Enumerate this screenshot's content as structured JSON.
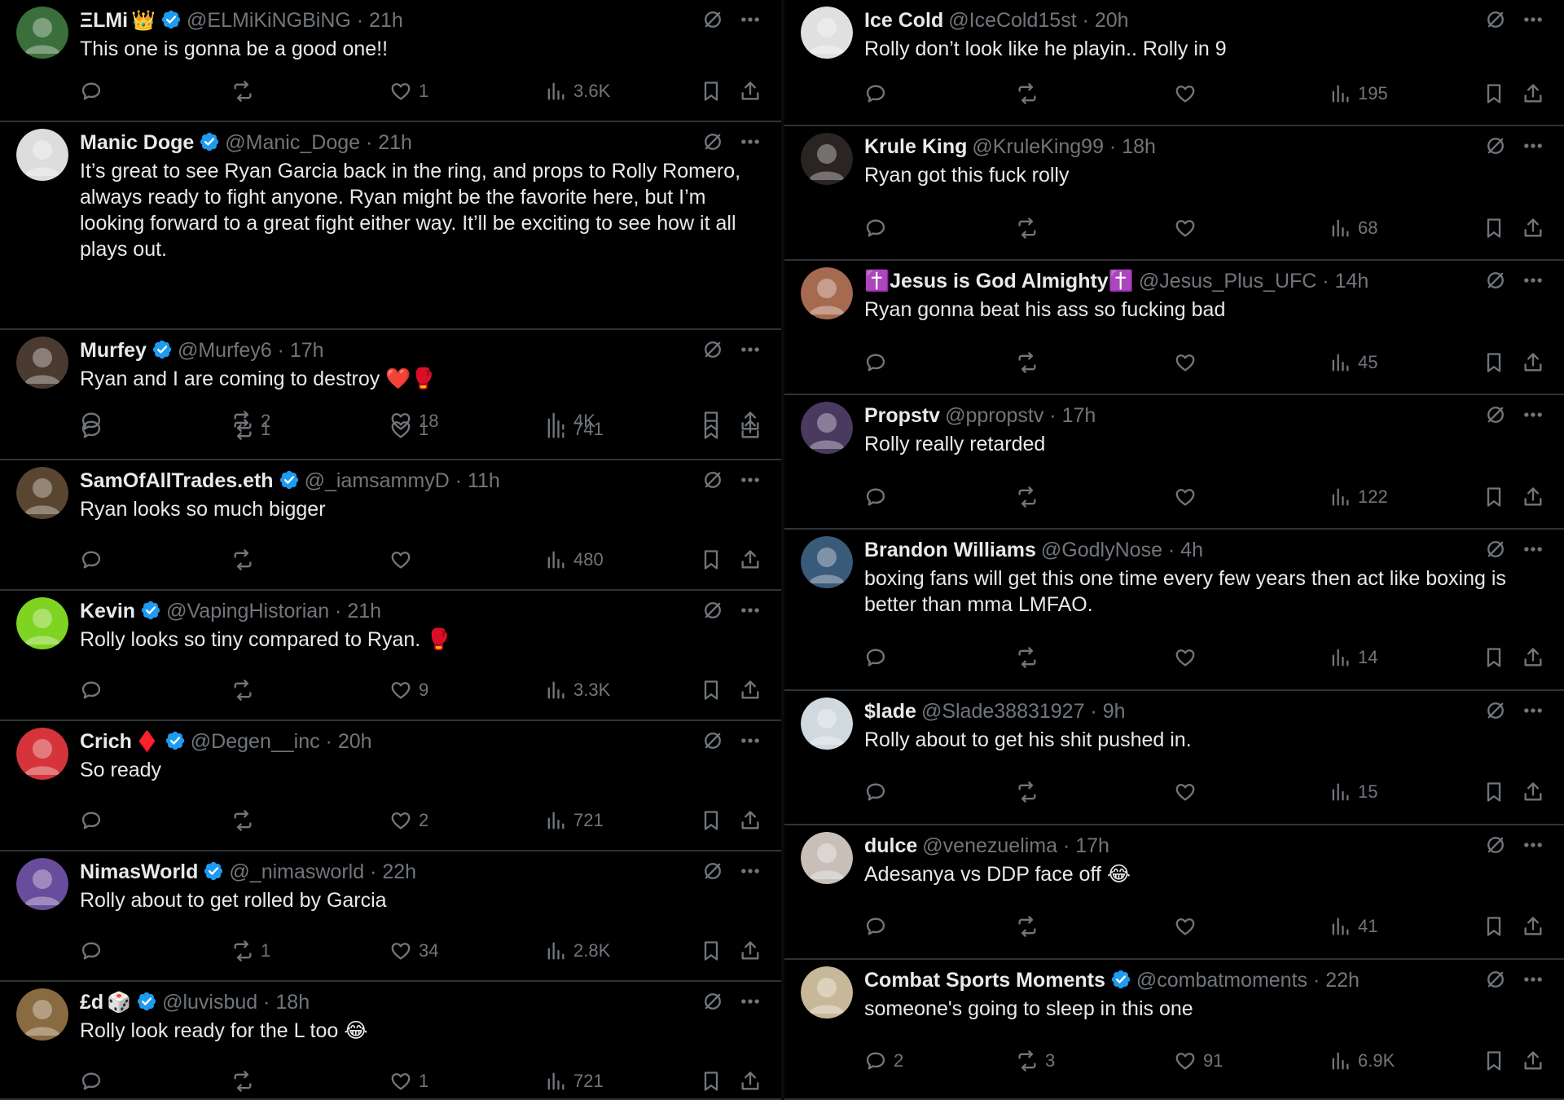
{
  "left": [
    {
      "name": "ΞLMi",
      "emoji": "👑",
      "verified": true,
      "handle": "@ELMiKiNGBiNG",
      "time": "21h",
      "text": "This one is gonna be a good one!!",
      "reply": "",
      "rt": "",
      "like": "1",
      "views": "3.6K",
      "avatar_color": "#3a6e3a"
    },
    {
      "name": "Manic Doge",
      "emoji": "",
      "verified": true,
      "handle": "@Manic_Doge",
      "time": "21h",
      "text": "It’s great to see Ryan Garcia back in the ring, and props to Rolly Romero, always ready to fight anyone. Ryan might be the favorite here, but I’m looking forward to a great fight either way. It’ll be exciting to see how it all plays out.",
      "reply": "",
      "rt": "2",
      "like": "18",
      "views": "4K",
      "avatar_color": "#dddddd"
    },
    {
      "name": "Murfey",
      "emoji": "",
      "verified": true,
      "handle": "@Murfey6",
      "time": "17h",
      "text": "Ryan and I are coming to destroy ❤️🥊",
      "reply": "",
      "rt": "1",
      "like": "1",
      "views": "741",
      "avatar_color": "#4a3a30"
    },
    {
      "name": "SamOfAllTrades.eth",
      "emoji": "",
      "verified": true,
      "handle": "@_iamsammyD",
      "time": "11h",
      "text": "Ryan looks so much bigger",
      "reply": "",
      "rt": "",
      "like": "",
      "views": "480",
      "avatar_color": "#5a4630"
    },
    {
      "name": "Kevin",
      "emoji": "",
      "verified": true,
      "handle": "@VapingHistorian",
      "time": "21h",
      "text": "Rolly looks so tiny compared to Ryan. 🥊",
      "reply": "",
      "rt": "",
      "like": "9",
      "views": "3.3K",
      "avatar_color": "#7fd321"
    },
    {
      "name": "Crich",
      "emoji": "♦️",
      "verified": true,
      "handle": "@Degen__inc",
      "time": "20h",
      "text": "So ready",
      "reply": "",
      "rt": "",
      "like": "2",
      "views": "721",
      "avatar_color": "#d4343a"
    },
    {
      "name": "NimasWorld",
      "emoji": "",
      "verified": true,
      "handle": "@_nimasworld",
      "time": "22h",
      "text": "Rolly about to get rolled by Garcia",
      "reply": "",
      "rt": "1",
      "like": "34",
      "views": "2.8K",
      "avatar_color": "#6a4c9c"
    },
    {
      "name": "£d",
      "emoji": "🎲",
      "verified": true,
      "handle": "@luvisbud",
      "time": "18h",
      "text": "Rolly look ready for the L too 😂",
      "reply": "",
      "rt": "",
      "like": "1",
      "views": "721",
      "avatar_color": "#8a6a40"
    }
  ],
  "right": [
    {
      "name": "Ice Cold",
      "emoji": "",
      "verified": false,
      "handle": "@IceCold15st",
      "time": "20h",
      "text": "Rolly don’t look like he playin.. Rolly in 9",
      "reply": "",
      "rt": "",
      "like": "",
      "views": "195",
      "avatar_color": "#e0e0e0"
    },
    {
      "name": "Krule King",
      "emoji": "",
      "verified": false,
      "handle": "@KruleKing99",
      "time": "18h",
      "text": "Ryan got this fuck rolly",
      "reply": "",
      "rt": "",
      "like": "",
      "views": "68",
      "avatar_color": "#2a2422"
    },
    {
      "name": "✝️Jesus is God Almighty✝️",
      "emoji": "",
      "verified": false,
      "handle": "@Jesus_Plus_UFC",
      "time": "14h",
      "text": "Ryan gonna beat his ass so fucking bad",
      "reply": "",
      "rt": "",
      "like": "",
      "views": "45",
      "avatar_color": "#a66a50"
    },
    {
      "name": "Propstv",
      "emoji": "",
      "verified": false,
      "handle": "@ppropstv",
      "time": "17h",
      "text": "Rolly really retarded",
      "reply": "",
      "rt": "",
      "like": "",
      "views": "122",
      "avatar_color": "#4a3a60"
    },
    {
      "name": "Brandon Williams",
      "emoji": "",
      "verified": false,
      "handle": "@GodlyNose",
      "time": "4h",
      "text": "boxing fans will get this one time every few years then act like boxing is better than mma LMFAO.",
      "reply": "",
      "rt": "",
      "like": "",
      "views": "14",
      "avatar_color": "#3a5a7a"
    },
    {
      "name": "$lade",
      "emoji": "",
      "verified": false,
      "handle": "@Slade38831927",
      "time": "9h",
      "text": "Rolly about to get his shit pushed in.",
      "reply": "",
      "rt": "",
      "like": "",
      "views": "15",
      "avatar_color": "#cfd9de"
    },
    {
      "name": "dulce",
      "emoji": "",
      "verified": false,
      "handle": "@venezuelima",
      "time": "17h",
      "text": "Adesanya vs DDP face off 😂",
      "reply": "",
      "rt": "",
      "like": "",
      "views": "41",
      "avatar_color": "#c8c0b8"
    },
    {
      "name": "Combat Sports Moments",
      "emoji": "",
      "verified": true,
      "handle": "@combatmoments",
      "time": "22h",
      "text": "someone's going to sleep in this one",
      "reply": "2",
      "rt": "3",
      "like": "91",
      "views": "6.9K",
      "avatar_color": "#c8b89a"
    }
  ],
  "colors": {
    "background": "#000000",
    "text": "#e7e9ea",
    "muted": "#71767b",
    "divider": "#2f3336",
    "verified": "#1d9bf0"
  },
  "icons": [
    "reply-icon",
    "retweet-icon",
    "like-icon",
    "views-icon",
    "bookmark-icon",
    "share-icon",
    "grok-icon",
    "more-icon",
    "verified-icon"
  ]
}
